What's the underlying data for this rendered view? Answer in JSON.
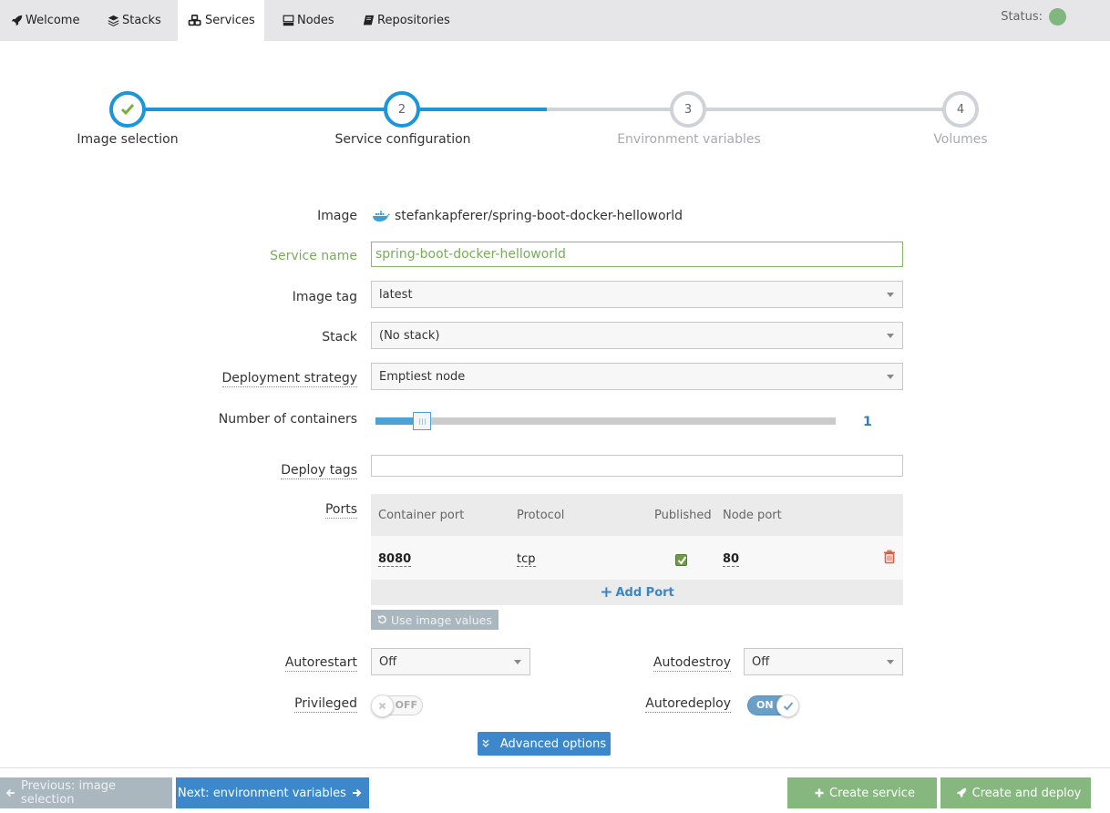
{
  "nav": {
    "tabs": [
      {
        "label": "Welcome",
        "icon": "rocket-icon",
        "active": false
      },
      {
        "label": "Stacks",
        "icon": "stack-icon",
        "active": false
      },
      {
        "label": "Services",
        "icon": "cubes-icon",
        "active": true
      },
      {
        "label": "Nodes",
        "icon": "server-icon",
        "active": false
      },
      {
        "label": "Repositories",
        "icon": "book-icon",
        "active": false
      }
    ],
    "status_label": "Status:",
    "status_color": "#7fb77e"
  },
  "wizard": {
    "steps": [
      {
        "number": "1",
        "label": "Image selection",
        "state": "done"
      },
      {
        "number": "2",
        "label": "Service configuration",
        "state": "current"
      },
      {
        "number": "3",
        "label": "Environment variables",
        "state": "pending"
      },
      {
        "number": "4",
        "label": "Volumes",
        "state": "pending"
      }
    ],
    "accent": "#1a96d9"
  },
  "form": {
    "image_label": "Image",
    "image_value": "stefankapferer/spring-boot-docker-helloworld",
    "service_name_label": "Service name",
    "service_name_value": "spring-boot-docker-helloworld",
    "image_tag_label": "Image tag",
    "image_tag_value": "latest",
    "stack_label": "Stack",
    "stack_value": "(No stack)",
    "deployment_strategy_label": "Deployment strategy",
    "deployment_strategy_value": "Emptiest node",
    "containers_label": "Number of containers",
    "containers_value": "1",
    "containers_slider_fraction": 0.1,
    "deploy_tags_label": "Deploy tags",
    "deploy_tags_value": "",
    "ports_label": "Ports",
    "ports": {
      "headers": [
        "Container port",
        "Protocol",
        "Published",
        "Node port"
      ],
      "rows": [
        {
          "container_port": "8080",
          "protocol": "tcp",
          "published": true,
          "node_port": "80"
        }
      ],
      "add_label": "Add Port"
    },
    "use_image_values_label": "Use image values",
    "autorestart_label": "Autorestart",
    "autorestart_value": "Off",
    "autodestroy_label": "Autodestroy",
    "autodestroy_value": "Off",
    "privileged_label": "Privileged",
    "privileged_state": "OFF",
    "autoredeploy_label": "Autoredeploy",
    "autoredeploy_state": "ON",
    "advanced_label": "Advanced options"
  },
  "footer": {
    "prev_label": "Previous: image selection",
    "next_label": "Next: environment variables",
    "create_label": "Create service",
    "create_deploy_label": "Create and deploy"
  }
}
